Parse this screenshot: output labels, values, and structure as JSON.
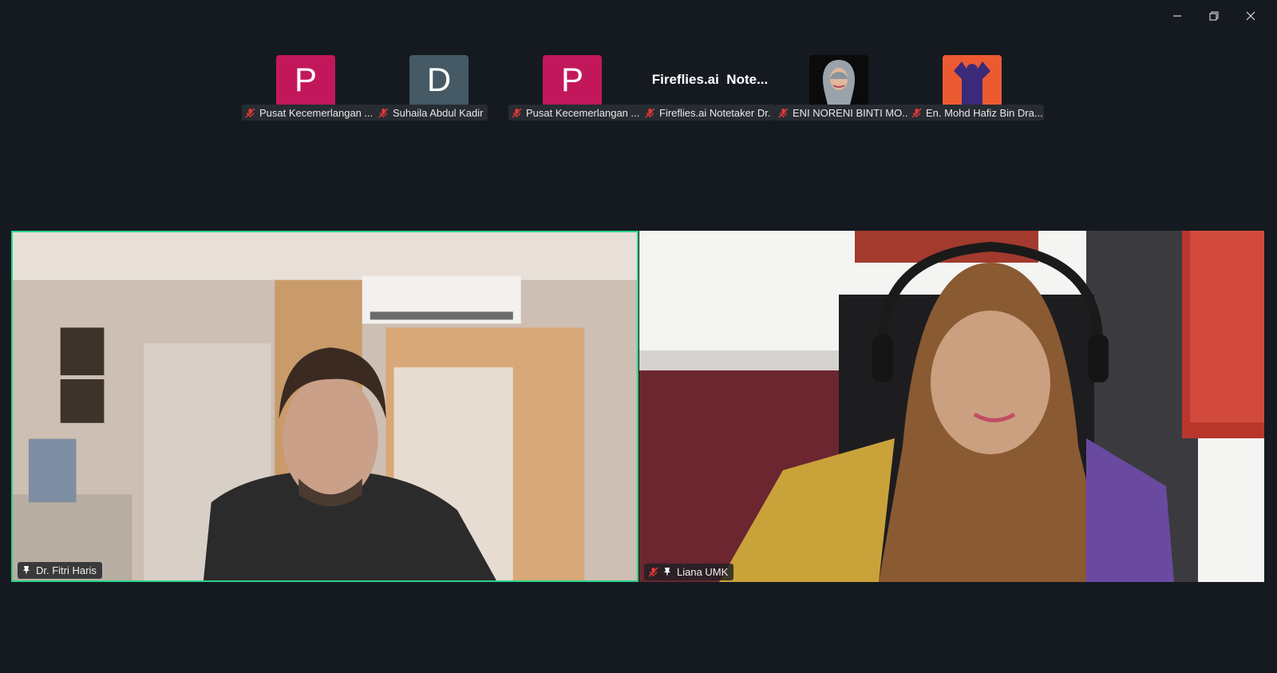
{
  "window_controls": {
    "minimize": "minimize",
    "restore": "restore",
    "close": "close"
  },
  "participants_strip": [
    {
      "initial": "P",
      "name": "Pusat Kecemerlangan ...",
      "avatar_color": "#c2185b",
      "muted": true
    },
    {
      "initial": "D",
      "name": "Suhaila Abdul Kadir",
      "avatar_color": "#455a64",
      "muted": true
    },
    {
      "initial": "P",
      "name": "Pusat Kecemerlangan ...",
      "avatar_color": "#c2185b",
      "muted": true
    },
    {
      "display_text": "Fireflies.ai  Note...",
      "name": "Fireflies.ai Notetaker Dr.",
      "muted": true
    },
    {
      "name": "ENI NORENI BINTI MO...",
      "muted": true,
      "avatar": "photo"
    },
    {
      "name": "En. Mohd Hafiz Bin Dra...",
      "muted": true,
      "avatar": "photo-orange"
    }
  ],
  "main_videos": [
    {
      "name": "Dr. Fitri Haris",
      "pinned": true,
      "muted": false,
      "active_speaker": true
    },
    {
      "name": "Liana UMK",
      "pinned": true,
      "muted": true,
      "active_speaker": false
    }
  ],
  "colors": {
    "background": "#141a20",
    "active_border": "#2bd48a",
    "mute_red": "#e53935"
  }
}
